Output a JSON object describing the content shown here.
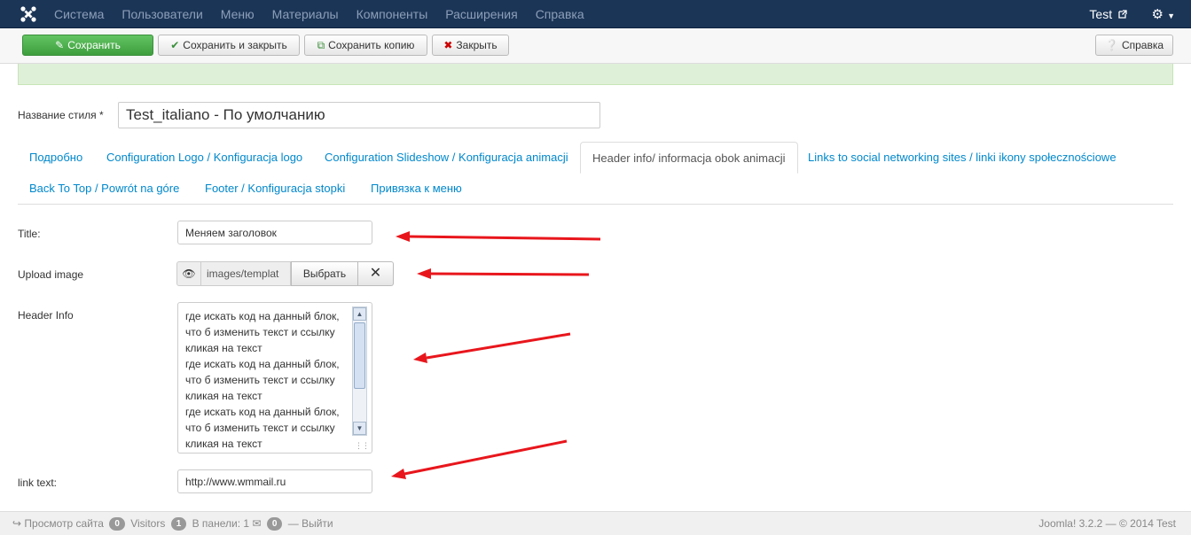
{
  "navbar": {
    "menu": [
      "Система",
      "Пользователи",
      "Меню",
      "Материалы",
      "Компоненты",
      "Расширения",
      "Справка"
    ],
    "user": "Test",
    "logo_icon": "joomla-logo-icon",
    "settings_icon": "gear-icon"
  },
  "toolbar": {
    "save": "Сохранить",
    "save_close": "Сохранить и закрыть",
    "save_copy": "Сохранить копию",
    "close": "Закрыть",
    "help": "Справка"
  },
  "form": {
    "style_name_label": "Название стиля *",
    "style_name_value": "Test_italiano - По умолчанию"
  },
  "tabs": [
    "Подробно",
    "Configuration Logo / Konfiguracja logo",
    "Configuration Slideshow / Konfiguracja animacji",
    "Header info/ informacja obok animacji",
    "Links to social networking sites / linki ikony społecznościowe",
    "Back To Top / Powrót na góre",
    "Footer / Konfiguracja stopki",
    "Привязка к меню"
  ],
  "active_tab_index": 3,
  "fields": {
    "title_label": "Title:",
    "title_value": "Меняем заголовок",
    "upload_label": "Upload image",
    "upload_path": "images/templat",
    "upload_choose": "Выбрать",
    "header_info_label": "Header Info",
    "header_info_value": "где искать код на данный блок, что б изменить текст и ссылку кликая на текст\nгде искать код на данный блок, что б изменить текст и ссылку кликая на текст\nгде искать код на данный блок, что б изменить текст и ссылку кликая на текст",
    "link_text_label": "link text:",
    "link_text_value": "http://www.wmmail.ru"
  },
  "footer": {
    "view_site": "Просмотр сайта",
    "visitors_count": "0",
    "visitors_label": "Visitors",
    "admin_count": "1",
    "admin_label": "В панели: 1",
    "messages_count": "0",
    "logout": "Выйти",
    "version": "Joomla! 3.2.2 — © 2014 Test"
  },
  "colors": {
    "navbar": "#1b3557",
    "save_button": "#4cae4c",
    "link": "#0088cc",
    "annotation_arrow": "#e8161c"
  }
}
